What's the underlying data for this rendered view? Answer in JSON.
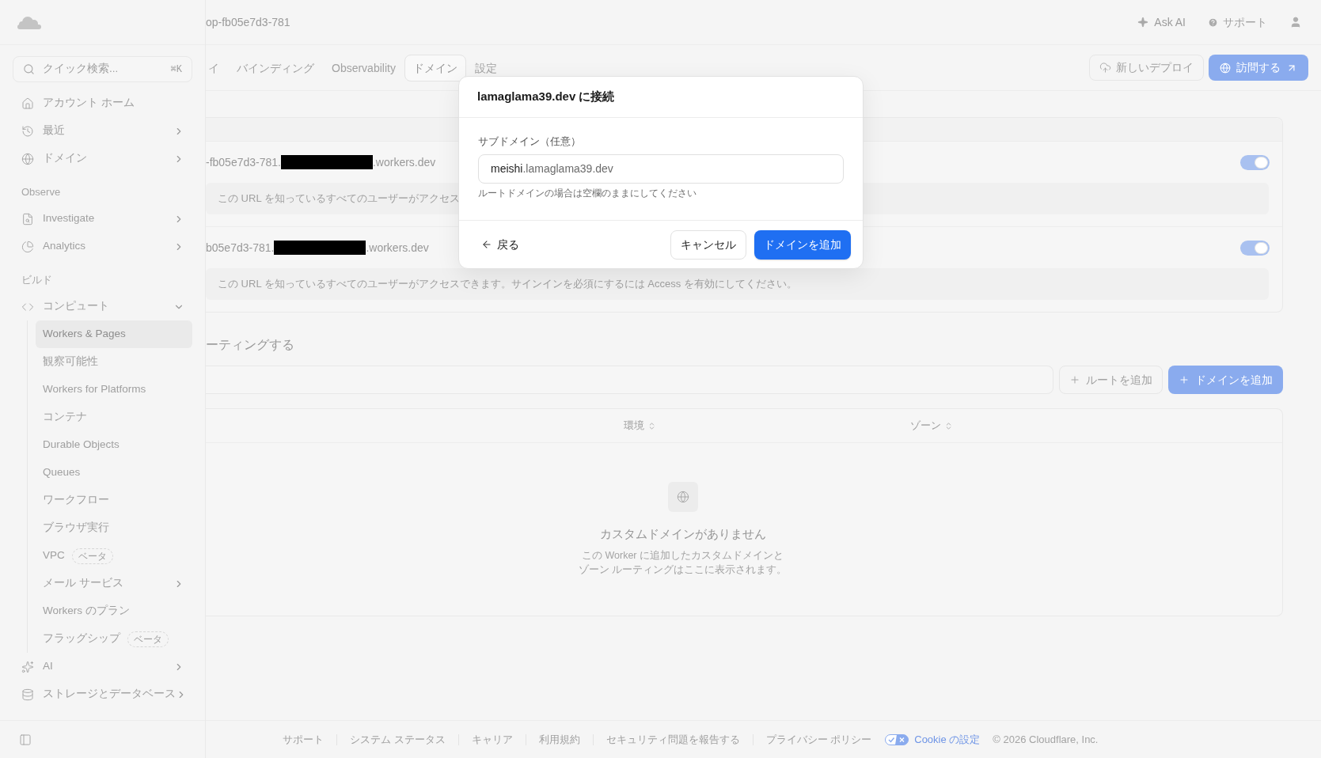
{
  "header": {
    "breadcrumb": "op-fb05e7d3-781",
    "actions": [
      {
        "kind": "ai",
        "label": "Ask AI"
      },
      {
        "kind": "help",
        "label": "サポート"
      },
      {
        "kind": "account"
      }
    ]
  },
  "sidebar": {
    "search": {
      "placeholder": "クイック検索...",
      "shortcut": "⌘K"
    },
    "sections": [
      {
        "items": [
          {
            "kind": "link",
            "label": "アカウント ホーム",
            "selected": false
          },
          {
            "kind": "group",
            "label": "最近",
            "expanded": false,
            "selected": false
          },
          {
            "kind": "group",
            "label": "ドメイン",
            "expanded": false,
            "selected": false
          }
        ]
      },
      {
        "heading": "Observe",
        "items": [
          {
            "kind": "group",
            "label": "Investigate",
            "expanded": false,
            "selected": false
          },
          {
            "kind": "group",
            "label": "Analytics",
            "expanded": false,
            "selected": false
          }
        ]
      },
      {
        "heading": "ビルド",
        "items": [
          {
            "kind": "group",
            "label": "コンピュート",
            "expanded": true,
            "selected": false,
            "children": [
              {
                "kind": "link",
                "label": "Workers & Pages",
                "selected": true
              },
              {
                "kind": "link",
                "label": "観察可能性",
                "selected": false
              },
              {
                "kind": "link",
                "label": "Workers for Platforms",
                "selected": false
              },
              {
                "kind": "link",
                "label": "コンテナ",
                "selected": false
              },
              {
                "kind": "link",
                "label": "Durable Objects",
                "selected": false
              },
              {
                "kind": "link",
                "label": "Queues",
                "selected": false
              },
              {
                "kind": "link",
                "label": "ワークフロー",
                "selected": false
              },
              {
                "kind": "link",
                "label": "ブラウザ実行",
                "selected": false
              },
              {
                "kind": "link",
                "label": "VPC",
                "badge": "ベータ",
                "selected": false
              },
              {
                "kind": "group",
                "label": "メール サービス",
                "expanded": false,
                "selected": false
              },
              {
                "kind": "link",
                "label": "Workers のプラン",
                "selected": false
              },
              {
                "kind": "link",
                "label": "フラッグシップ",
                "badge": "ベータ",
                "selected": false
              }
            ]
          },
          {
            "kind": "group",
            "label": "AI",
            "expanded": false,
            "selected": false
          },
          {
            "kind": "group",
            "label": "ストレージとデータベース",
            "expanded": false,
            "selected": false
          }
        ]
      }
    ]
  },
  "tabs": [
    {
      "label": "イ",
      "selected": false
    },
    {
      "label": "バインディング",
      "selected": false
    },
    {
      "label": "Observability",
      "selected": false
    },
    {
      "label": "ドメイン",
      "selected": true
    },
    {
      "label": "設定",
      "selected": false
    }
  ],
  "page_actions": [
    {
      "kind": "deploy",
      "label": "新しいデプロイ"
    },
    {
      "kind": "visit",
      "label": "訪問する"
    }
  ],
  "domains": {
    "rows": [
      {
        "host_start": "-fb05e7d3-781.",
        "redacted": true,
        "host_end": ".workers.dev",
        "enabled": true,
        "note": "この URL を知っているすべてのユーザーがアクセス"
      },
      {
        "host_start": "b05e7d3-781.",
        "redacted": true,
        "host_end": ".workers.dev",
        "enabled": true,
        "note": "この URL を知っているすべてのユーザーがアクセスできます。サインインを必須にするには Access を有効にしてください。"
      }
    ]
  },
  "routing": {
    "title": "ーティングする",
    "actions": [
      {
        "kind": "outline",
        "label": "ルートを追加"
      },
      {
        "kind": "primary",
        "label": "ドメインを追加"
      }
    ],
    "table": {
      "columns": [
        {
          "label": "環境",
          "sortable": true
        },
        {
          "label": "ゾーン",
          "sortable": true
        }
      ],
      "empty": {
        "title": "カスタムドメインがありません",
        "lines": [
          "この Worker に追加したカスタムドメインと",
          "ゾーン ルーティングはここに表示されます。"
        ]
      }
    }
  },
  "dialog": {
    "title": "lamaglama39.dev に接続",
    "field": {
      "label": "サブドメイン（任意）",
      "value": "meishi",
      "suffix": ".lamaglama39.dev",
      "hint": "ルートドメインの場合は空欄のままにしてください"
    },
    "back": "戻る",
    "buttons": [
      {
        "kind": "secondary",
        "label": "キャンセル"
      },
      {
        "kind": "primary",
        "label": "ドメインを追加"
      }
    ]
  },
  "footer": {
    "links": [
      "サポート",
      "システム ステータス",
      "キャリア",
      "利用規約",
      "セキュリティ問題を報告する",
      "プライバシー ポリシー"
    ],
    "cookie": "Cookie の設定",
    "copyright": "© 2026 Cloudflare, Inc."
  }
}
